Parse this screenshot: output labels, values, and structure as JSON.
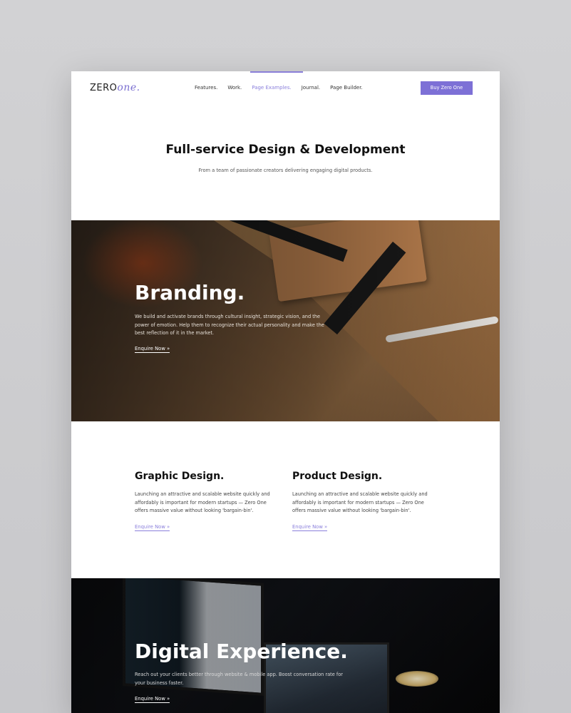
{
  "header": {
    "logo_main": "ZERO",
    "logo_accent": "one.",
    "nav": [
      "Features.",
      "Work.",
      "Page Examples.",
      "Journal.",
      "Page Builder."
    ],
    "buy_label": "Buy Zero One"
  },
  "hero": {
    "title": "Full-service Design & Development",
    "subtitle": "From a team of passionate creators delivering engaging digital products."
  },
  "branding": {
    "title": "Branding.",
    "text": "We build and activate brands through cultural insight, strategic vision, and the power of emotion. Help them to recognize their actual personality and make the best reflection of it in the market.",
    "link": "Enquire Now »"
  },
  "services": [
    {
      "title": "Graphic Design.",
      "text": "Launching an attractive and scalable website quickly and affordably is important for modern startups — Zero One offers massive value without looking 'bargain-bin'.",
      "link": "Enquire Now »"
    },
    {
      "title": "Product Design.",
      "text": "Launching an attractive and scalable website quickly and affordably is important for modern startups — Zero One offers massive value without looking 'bargain-bin'.",
      "link": "Enquire Now »"
    }
  ],
  "digital": {
    "title": "Digital Experience.",
    "text": "Reach out your clients better through website & mobile app. Boost conversation rate for your business faster.",
    "link": "Enquire Now »"
  },
  "colors": {
    "accent": "#7d70d6",
    "text": "#111111"
  }
}
